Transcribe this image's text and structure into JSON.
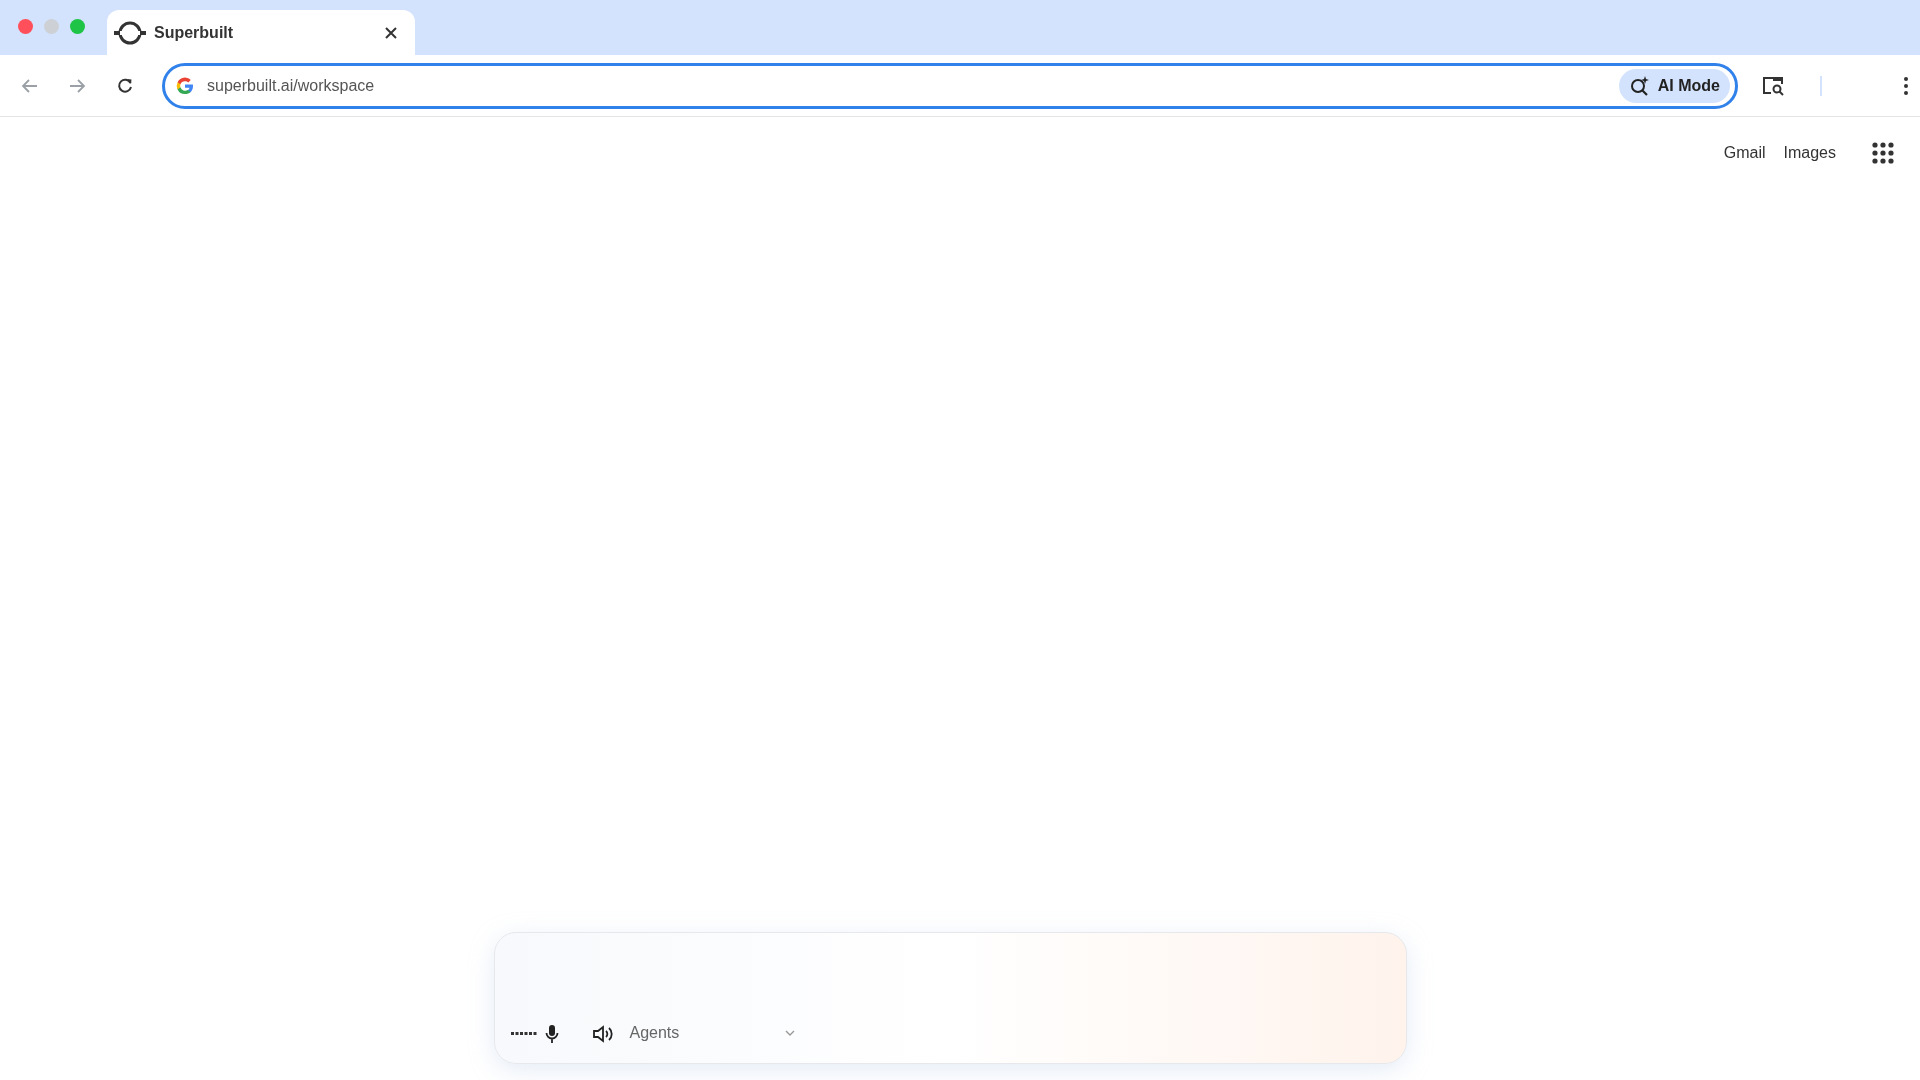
{
  "tab": {
    "title": "Superbuilt"
  },
  "address_bar": {
    "url": "superbuilt.ai/workspace",
    "ai_mode": "AI Mode"
  },
  "header_links": [
    "Gmail",
    "Images"
  ],
  "composer": {
    "agent_select": "Agents"
  }
}
